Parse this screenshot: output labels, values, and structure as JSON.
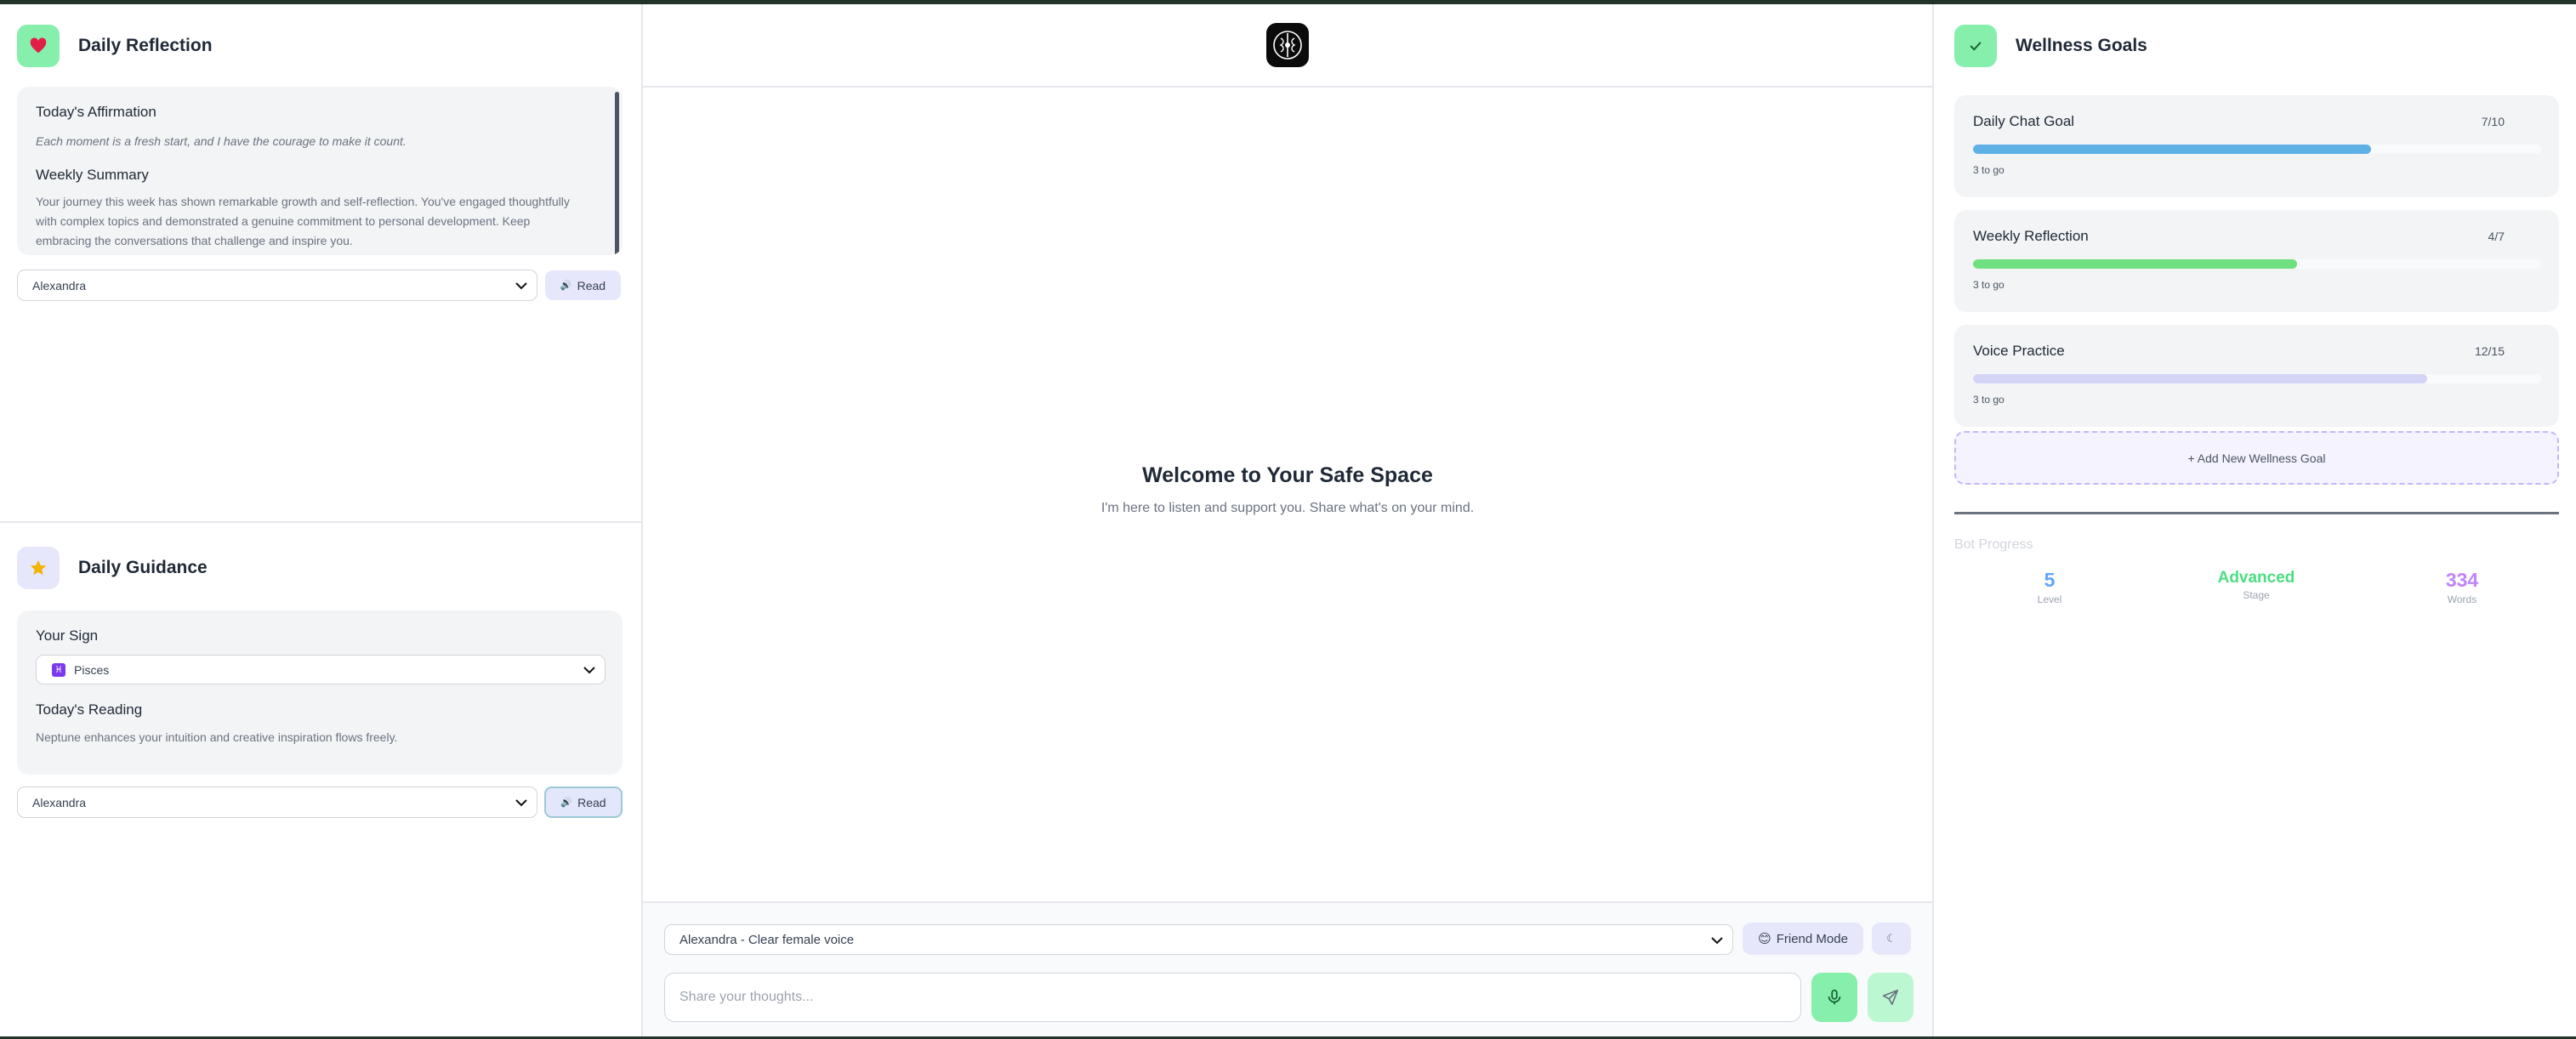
{
  "daily_reflection": {
    "title": "Daily Reflection",
    "affirmation_heading": "Today's Affirmation",
    "affirmation_text": "Each moment is a fresh start, and I have the courage to make it count.",
    "summary_heading": "Weekly Summary",
    "summary_text": "Your journey this week has shown remarkable growth and self-reflection. You've engaged thoughtfully with complex topics and demonstrated a genuine commitment to personal development. Keep embracing the conversations that challenge and inspire you.",
    "voice_selected": "Alexandra",
    "read_label": "Read"
  },
  "daily_guidance": {
    "title": "Daily Guidance",
    "sign_heading": "Your Sign",
    "sign_symbol": "♓",
    "sign_selected": "Pisces",
    "reading_heading": "Today's Reading",
    "reading_text": "Neptune enhances your intuition and creative inspiration flows freely.",
    "voice_selected": "Alexandra",
    "read_label": "Read"
  },
  "chat": {
    "welcome_title": "Welcome to Your Safe Space",
    "welcome_subtitle": "I'm here to listen and support you. Share what's on your mind.",
    "voice_selected": "Alexandra - Clear female voice",
    "friend_mode_label": "Friend Mode",
    "friend_mode_emoji": "😊",
    "theme_toggle_glyph": "☾",
    "input_placeholder": "Share your thoughts..."
  },
  "wellness_goals": {
    "title": "Wellness Goals",
    "goals": [
      {
        "name": "Daily Chat Goal",
        "count": "7/10",
        "progress": 0.7,
        "remaining": "3 to go",
        "color": "#60b0e8"
      },
      {
        "name": "Weekly Reflection",
        "count": "4/7",
        "progress": 0.571,
        "remaining": "3 to go",
        "color": "#6ee07f"
      },
      {
        "name": "Voice Practice",
        "count": "12/15",
        "progress": 0.8,
        "remaining": "3 to go",
        "color": "#d4d4f7"
      }
    ],
    "add_goal_label": "+ Add New Wellness Goal"
  },
  "bot_progress": {
    "title": "Bot Progress",
    "level_value": "5",
    "level_label": "Level",
    "stage_value": "Advanced",
    "stage_label": "Stage",
    "words_value": "334",
    "words_label": "Words"
  },
  "colors": {
    "accent_green": "#86efac",
    "accent_lavender": "#e6e7fb",
    "level_blue": "#60a5fa",
    "stage_green": "#4ade80",
    "words_purple": "#c084fc"
  }
}
